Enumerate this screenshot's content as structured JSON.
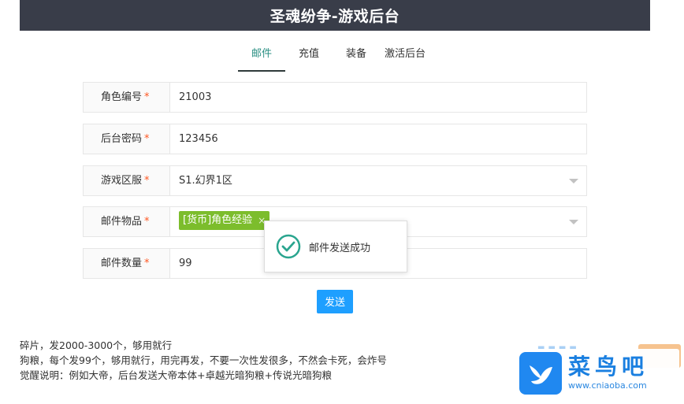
{
  "header": {
    "title": "圣魂纷争-游戏后台"
  },
  "tabs": [
    {
      "label": "邮件",
      "active": true
    },
    {
      "label": "充值",
      "active": false
    },
    {
      "label": "装备",
      "active": false
    },
    {
      "label": "激活后台",
      "active": false
    }
  ],
  "form": {
    "required_mark": "*",
    "role_id": {
      "label": "角色编号",
      "value": "21003"
    },
    "password": {
      "label": "后台密码",
      "value": "123456"
    },
    "server": {
      "label": "游戏区服",
      "value": "S1.幻界1区"
    },
    "item": {
      "label": "邮件物品",
      "tag": "[货币]角色经验",
      "tag_close": "×"
    },
    "quantity": {
      "label": "邮件数量",
      "value": "99"
    },
    "send_label": "发送"
  },
  "toast": {
    "message": "邮件发送成功"
  },
  "notes": [
    "碎片，发2000-3000个，够用就行",
    "狗粮，每个发99个，够用就行，用完再发，不要一次性发很多，不然会卡死，会炸号",
    "觉醒说明：例如大帝，后台发送大帝本体+卓越光暗狗粮+传说光暗狗粮"
  ],
  "watermark": {
    "name": "菜鸟吧",
    "url": "www.cniaoba.com"
  },
  "colors": {
    "header_bg": "#393d49",
    "active_tab": "#2a8f83",
    "button": "#1e9fff",
    "tag": "#7cbd2c",
    "required": "#ff5722"
  }
}
